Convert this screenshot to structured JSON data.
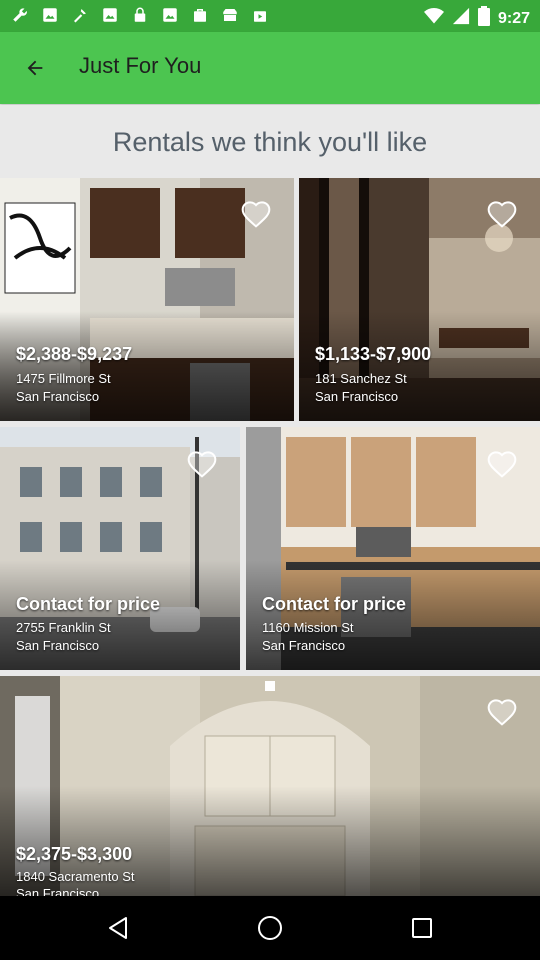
{
  "status_bar": {
    "time": "9:27",
    "left_icons": [
      "wrench-icon",
      "image-icon",
      "tools-icon",
      "image-icon",
      "lock-icon",
      "image-icon",
      "bag-icon",
      "store-icon",
      "bag-icon"
    ],
    "right_icons": [
      "wifi-icon",
      "signal-icon",
      "battery-icon"
    ]
  },
  "app_bar": {
    "title": "Just For You",
    "back_icon": "arrow-back-icon",
    "color": "#4cc550"
  },
  "section_title": "Rentals we think you'll like",
  "listings": [
    {
      "price": "$2,388-$9,237",
      "address": "1475 Fillmore St",
      "city": "San Francisco"
    },
    {
      "price": "$1,133-$7,900",
      "address": "181 Sanchez St",
      "city": "San Francisco"
    },
    {
      "price": "Contact for price",
      "address": "2755 Franklin St",
      "city": "San Francisco"
    },
    {
      "price": "Contact for price",
      "address": "1160 Mission St",
      "city": "San Francisco"
    },
    {
      "price": "$2,375-$3,300",
      "address": "1840 Sacramento St",
      "city": "San Francisco"
    }
  ],
  "nav_bar": {
    "back": "nav-back-icon",
    "home": "nav-home-icon",
    "recents": "nav-recents-icon"
  }
}
